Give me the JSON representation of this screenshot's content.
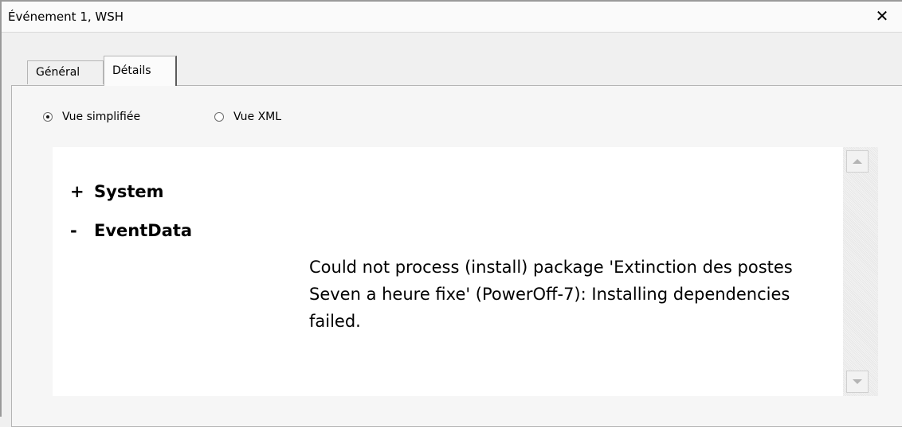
{
  "window": {
    "title": "Événement 1, WSH",
    "close_symbol": "✕"
  },
  "tabs": [
    {
      "label": "Général",
      "selected": false
    },
    {
      "label": "Détails",
      "selected": true
    }
  ],
  "view_options": [
    {
      "label": "Vue simplifiée",
      "selected": true
    },
    {
      "label": "Vue XML",
      "selected": false
    }
  ],
  "details": {
    "nodes": [
      {
        "sign": "+",
        "label": "System",
        "expanded": false
      },
      {
        "sign": "-",
        "label": "EventData",
        "expanded": true
      }
    ],
    "message": "Could not process (install) package 'Extinction des postes Seven a heure fixe' (PowerOff-7): Installing dependencies failed."
  },
  "icons": {
    "close": "close-icon",
    "radio": "radio-button-icon",
    "scroll_up": "arrow-up-icon",
    "scroll_down": "arrow-down-icon"
  }
}
